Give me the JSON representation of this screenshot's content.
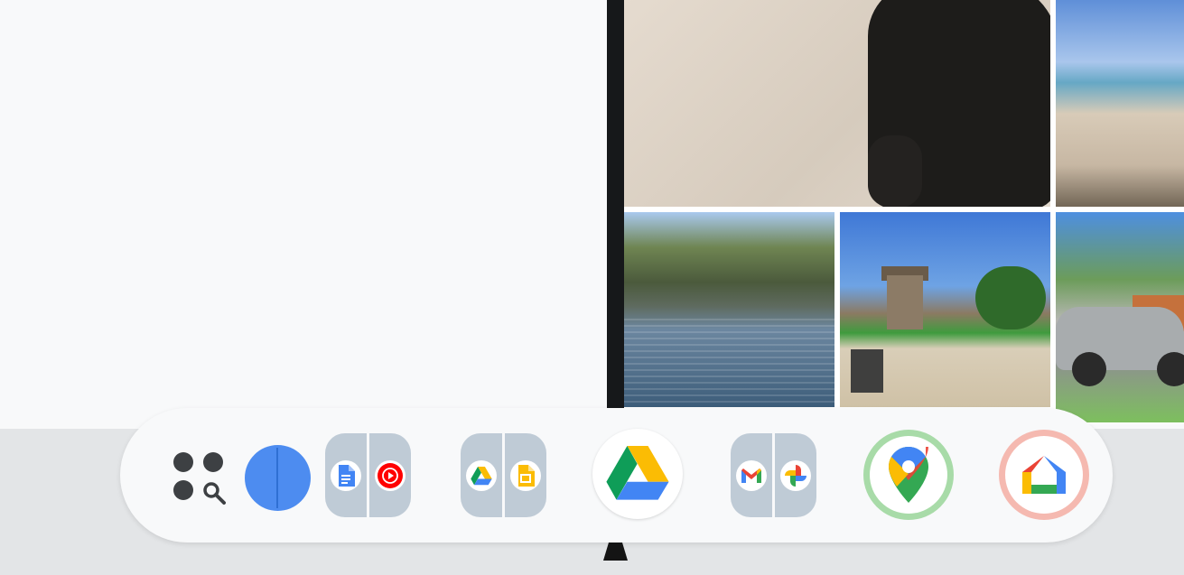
{
  "split_view": {
    "left_app": "blank",
    "right_app": "photo-gallery",
    "photos": [
      "bear",
      "beach",
      "lake",
      "building",
      "car"
    ]
  },
  "taskbar": {
    "launcher": {
      "icon": "launcher-search-icon"
    },
    "items": [
      {
        "type": "circle",
        "icon": "split-circle-icon"
      },
      {
        "type": "pair",
        "left_icon": "docs-icon",
        "right_icon": "youtube-music-icon"
      },
      {
        "type": "pair",
        "left_icon": "drive-icon",
        "right_icon": "slides-icon"
      },
      {
        "type": "single",
        "icon": "drive-icon",
        "state": "active"
      },
      {
        "type": "pair",
        "left_icon": "gmail-icon",
        "right_icon": "photos-icon"
      },
      {
        "type": "single",
        "icon": "maps-icon",
        "ring_color": "#a8dba8"
      },
      {
        "type": "single",
        "icon": "home-icon",
        "ring_color": "#f5b9b0"
      }
    ]
  },
  "colors": {
    "shelf_bg": "#f8f9fa",
    "bottom_strip": "#e3e5e7",
    "divider": "#16181a",
    "pair_tile": "#bfcbd6",
    "accent_blue": "#4d8cf0"
  }
}
